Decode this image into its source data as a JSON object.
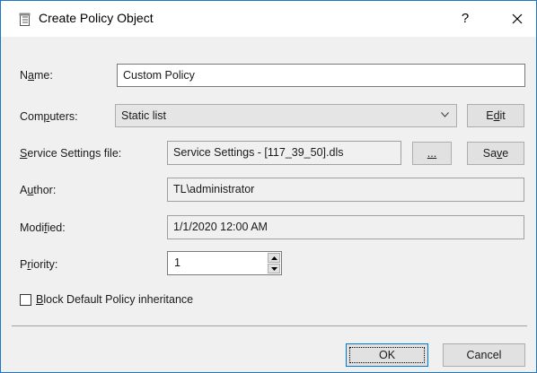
{
  "window": {
    "title": "Create Policy Object",
    "help_label": "?",
    "icon": "notepad-icon",
    "close_icon": "close-icon"
  },
  "form": {
    "name_label": {
      "pre": "N",
      "u": "a",
      "post": "me:"
    },
    "name_value": "Custom Policy",
    "computers_label": {
      "pre": "Com",
      "u": "p",
      "post": "uters:"
    },
    "computers_selected": "Static list",
    "edit_button": {
      "pre": "E",
      "u": "d",
      "post": "it"
    },
    "service_label": {
      "pre": "",
      "u": "S",
      "post": "ervice Settings file:"
    },
    "service_value": "Service Settings - [117_39_50].dls",
    "browse_button": {
      "pre": "",
      "u": "...",
      "post": ""
    },
    "save_button": {
      "pre": "Sa",
      "u": "v",
      "post": "e"
    },
    "author_label": {
      "pre": "A",
      "u": "u",
      "post": "thor:"
    },
    "author_value": "TL\\administrator",
    "modified_label": {
      "pre": "Modi",
      "u": "f",
      "post": "ied:"
    },
    "modified_value": "1/1/2020 12:00 AM",
    "priority_label": {
      "pre": "P",
      "u": "r",
      "post": "iority:"
    },
    "priority_value": "1",
    "inherit_label": {
      "pre": "",
      "u": "B",
      "post": "lock Default Policy inheritance"
    },
    "inherit_checked": false
  },
  "footer": {
    "ok_label": "OK",
    "cancel_label": "Cancel"
  },
  "colors": {
    "window_border": "#1f77c4",
    "dialog_bg": "#f0f0f0",
    "default_button_border": "#0078d7"
  }
}
